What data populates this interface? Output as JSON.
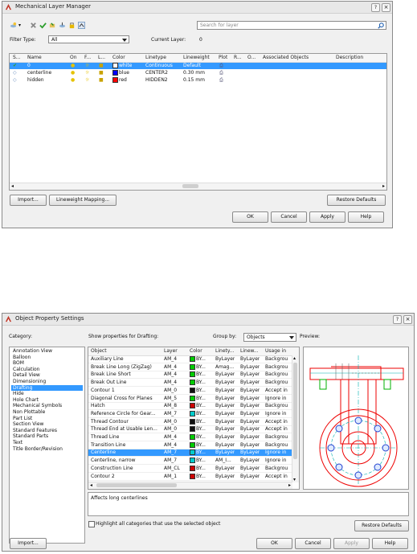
{
  "layer_manager": {
    "title": "Mechanical Layer Manager",
    "help_label": "?",
    "search_placeholder": "Search for layer",
    "filter_type_label": "Filter Type:",
    "filter_type_value": "All",
    "current_layer_label": "Current Layer:",
    "current_layer_value": "0",
    "columns": [
      "S...",
      "Name",
      "On",
      "F...",
      "L...",
      "Color",
      "Linetype",
      "Lineweight",
      "Plot",
      "R...",
      "O...",
      "Associated Objects",
      "Description"
    ],
    "rows": [
      {
        "name": "0",
        "color_name": "white",
        "color_hex": "#ffffff",
        "linetype": "Continuous",
        "lineweight": "Default",
        "selected": true
      },
      {
        "name": "centerline",
        "color_name": "blue",
        "color_hex": "#0000ff",
        "linetype": "CENTER2",
        "lineweight": "0.30 mm",
        "selected": false
      },
      {
        "name": "hidden",
        "color_name": "red",
        "color_hex": "#ff0000",
        "linetype": "HIDDEN2",
        "lineweight": "0.15 mm",
        "selected": false
      }
    ],
    "buttons": {
      "import": "Import...",
      "lineweight_mapping": "Lineweight Mapping...",
      "restore_defaults": "Restore Defaults",
      "ok": "OK",
      "cancel": "Cancel",
      "apply": "Apply",
      "help": "Help"
    }
  },
  "object_props": {
    "title": "Object Property Settings",
    "help_label": "?",
    "category_label": "Category:",
    "show_props_label": "Show properties for Drafting:",
    "group_by_label": "Group by:",
    "group_by_value": "Objects",
    "preview_label": "Preview:",
    "categories": [
      "Annotation View",
      "Balloon",
      "BOM",
      "Calculation",
      "Detail View",
      "Dimensioning",
      "Drafting",
      "Hide",
      "Hole Chart",
      "Mechanical Symbols",
      "Non Plottable",
      "Part List",
      "Section View",
      "Standard Features",
      "Standard Parts",
      "Text",
      "Title Border/Revision"
    ],
    "selected_category": "Drafting",
    "columns": [
      "Object",
      "Layer",
      "Color",
      "Linety...",
      "Linew...",
      "Usage in"
    ],
    "rows": [
      {
        "object": "Auxiliary Line",
        "layer": "AM_4",
        "color": "BY...",
        "color_hex": "#00cc00",
        "linetype": "ByLayer",
        "lineweight": "ByLayer",
        "usage": "Backgrou",
        "selected": false
      },
      {
        "object": "Break Line Long (ZigZag)",
        "layer": "AM_4",
        "color": "BY...",
        "color_hex": "#00cc00",
        "linetype": "Amag...",
        "lineweight": "ByLayer",
        "usage": "Backgrou",
        "selected": false
      },
      {
        "object": "Break Line Short",
        "layer": "AM_4",
        "color": "BY...",
        "color_hex": "#00cc00",
        "linetype": "ByLayer",
        "lineweight": "ByLayer",
        "usage": "Backgrou",
        "selected": false
      },
      {
        "object": "Break Out Line",
        "layer": "AM_4",
        "color": "BY...",
        "color_hex": "#00cc00",
        "linetype": "ByLayer",
        "lineweight": "ByLayer",
        "usage": "Backgrou",
        "selected": false
      },
      {
        "object": "Contour 1",
        "layer": "AM_0",
        "color": "BY...",
        "color_hex": "#111111",
        "linetype": "ByLayer",
        "lineweight": "ByLayer",
        "usage": "Accept in",
        "selected": false
      },
      {
        "object": "Diagonal Cross for Planes",
        "layer": "AM_5",
        "color": "BY...",
        "color_hex": "#00cc00",
        "linetype": "ByLayer",
        "lineweight": "ByLayer",
        "usage": "Ignore in",
        "selected": false
      },
      {
        "object": "Hatch",
        "layer": "AM_8",
        "color": "BY...",
        "color_hex": "#cc0000",
        "linetype": "ByLayer",
        "lineweight": "ByLayer",
        "usage": "Backgrou",
        "selected": false
      },
      {
        "object": "Reference Circle for Gear...",
        "layer": "AM_7",
        "color": "BY...",
        "color_hex": "#00cccc",
        "linetype": "ByLayer",
        "lineweight": "ByLayer",
        "usage": "Ignore in",
        "selected": false
      },
      {
        "object": "Thread Contour",
        "layer": "AM_0",
        "color": "BY...",
        "color_hex": "#111111",
        "linetype": "ByLayer",
        "lineweight": "ByLayer",
        "usage": "Accept in",
        "selected": false
      },
      {
        "object": "Thread End at Usable Len...",
        "layer": "AM_0",
        "color": "BY...",
        "color_hex": "#111111",
        "linetype": "ByLayer",
        "lineweight": "ByLayer",
        "usage": "Accept in",
        "selected": false
      },
      {
        "object": "Thread Line",
        "layer": "AM_4",
        "color": "BY...",
        "color_hex": "#00cc00",
        "linetype": "ByLayer",
        "lineweight": "ByLayer",
        "usage": "Backgrou",
        "selected": false
      },
      {
        "object": "Transition Line",
        "layer": "AM_4",
        "color": "BY...",
        "color_hex": "#00cc00",
        "linetype": "ByLayer",
        "lineweight": "ByLayer",
        "usage": "Backgrou",
        "selected": false
      },
      {
        "object": "Centerline",
        "layer": "AM_7",
        "color": "BY...",
        "color_hex": "#00cccc",
        "linetype": "ByLayer",
        "lineweight": "ByLayer",
        "usage": "Ignore in",
        "selected": true
      },
      {
        "object": "Centerline, narrow",
        "layer": "AM_7",
        "color": "BY...",
        "color_hex": "#00cccc",
        "linetype": "AM_I...",
        "lineweight": "ByLayer",
        "usage": "Ignore in",
        "selected": false
      },
      {
        "object": "Construction Line",
        "layer": "AM_CL",
        "color": "BY...",
        "color_hex": "#cc0000",
        "linetype": "ByLayer",
        "lineweight": "ByLayer",
        "usage": "Backgrou",
        "selected": false
      },
      {
        "object": "Contour 2",
        "layer": "AM_1",
        "color": "BY...",
        "color_hex": "#cc0000",
        "linetype": "ByLayer",
        "lineweight": "ByLayer",
        "usage": "Accept in",
        "selected": false
      }
    ],
    "description": "Affects long centerlines",
    "highlight_checkbox_label": "Highlight all categories that use the selected object",
    "buttons": {
      "restore_defaults": "Restore Defaults",
      "import": "Import...",
      "ok": "OK",
      "cancel": "Cancel",
      "apply": "Apply",
      "help": "Help"
    }
  }
}
